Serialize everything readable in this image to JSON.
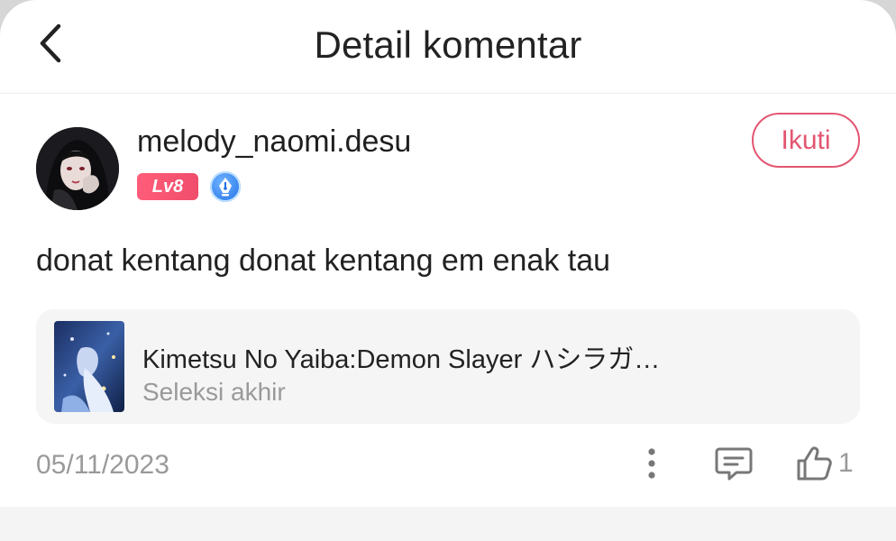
{
  "header": {
    "title": "Detail komentar",
    "back_icon": "chevron-left-icon"
  },
  "comment": {
    "username": "melody_naomi.desu",
    "level_badge": "Lv8",
    "creator_badge_icon": "pen-nib-icon",
    "follow_label": "Ikuti",
    "text": "donat kentang donat kentang em enak tau",
    "date": "05/11/2023",
    "like_count": "1"
  },
  "work": {
    "title": "Kimetsu No Yaiba:Demon Slayer ハシラガ…",
    "subtitle": "Seleksi akhir"
  },
  "colors": {
    "accent": "#e35671",
    "level_badge": "#f04d6c",
    "muted_text": "#9a9a9a"
  }
}
